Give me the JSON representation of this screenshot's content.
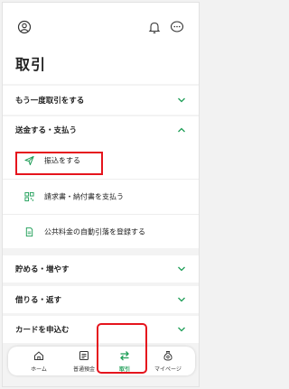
{
  "page_title": "取引",
  "sections": {
    "repeat": "もう一度取引をする",
    "send": "送金する・支払う",
    "save": "貯める・増やす",
    "borrow": "借りる・返す",
    "card": "カードを申込む"
  },
  "submenu": {
    "transfer": "振込をする",
    "bill": "請求書・納付書を支払う",
    "utility": "公共料金の自動引落を登録する"
  },
  "tabs": {
    "home": "ホーム",
    "deposit": "普通預金",
    "transaction": "取引",
    "mypage": "マイページ"
  },
  "colors": {
    "accent": "#1e9e57",
    "highlight": "#e5141d"
  }
}
